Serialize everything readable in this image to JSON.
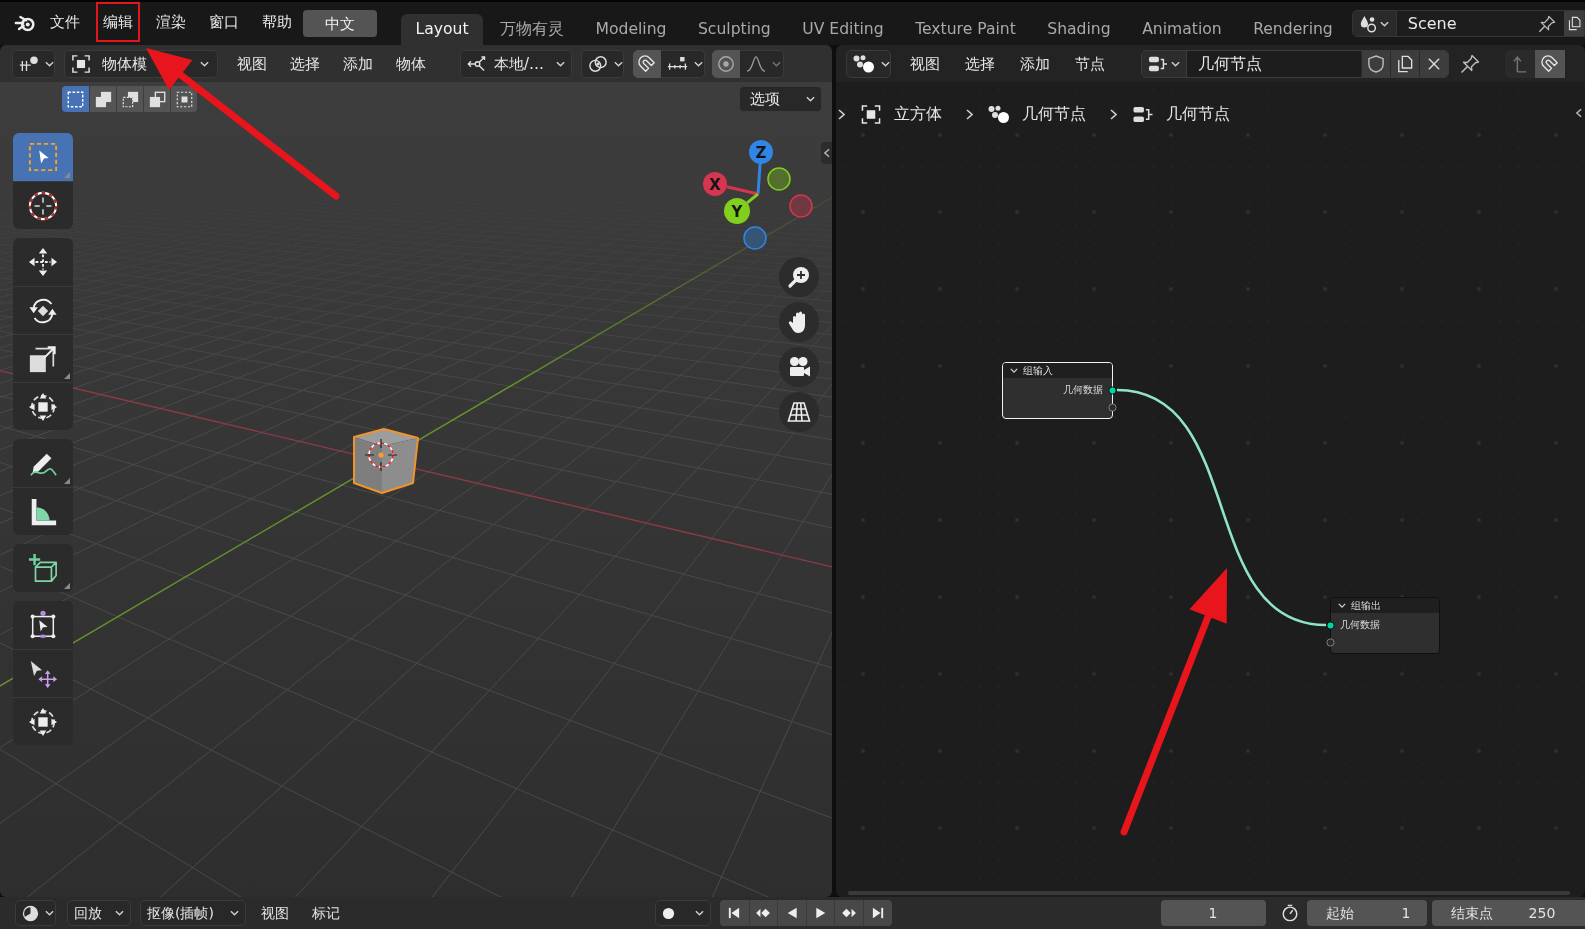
{
  "top_bar": {
    "menus": [
      {
        "label": "文件",
        "highlighted": false
      },
      {
        "label": "编辑",
        "highlighted": true
      },
      {
        "label": "渲染",
        "highlighted": false
      },
      {
        "label": "窗口",
        "highlighted": false
      },
      {
        "label": "帮助",
        "highlighted": false
      }
    ],
    "language": "中文",
    "workspaces": [
      {
        "label": "Layout",
        "selected": true
      },
      {
        "label": "万物有灵",
        "selected": false
      },
      {
        "label": "Modeling",
        "selected": false
      },
      {
        "label": "Sculpting",
        "selected": false
      },
      {
        "label": "UV Editing",
        "selected": false
      },
      {
        "label": "Texture Paint",
        "selected": false
      },
      {
        "label": "Shading",
        "selected": false
      },
      {
        "label": "Animation",
        "selected": false
      },
      {
        "label": "Rendering",
        "selected": false
      }
    ],
    "scene": "Scene"
  },
  "viewport": {
    "mode": "物体模",
    "menus": [
      "视图",
      "选择",
      "添加",
      "物体"
    ],
    "orientation": "本地/…",
    "select_modes": [
      {
        "kind": "set",
        "selected": true
      },
      {
        "kind": "extend",
        "selected": false
      },
      {
        "kind": "subtract",
        "selected": false
      },
      {
        "kind": "invert",
        "selected": false
      },
      {
        "kind": "intersect",
        "selected": false
      }
    ],
    "options": "选项",
    "tool_groups": [
      [
        {
          "kind": "select-box",
          "selected": true,
          "submenu": true
        },
        {
          "kind": "cursor",
          "selected": false,
          "submenu": false
        }
      ],
      [
        {
          "kind": "move",
          "selected": false,
          "submenu": false
        },
        {
          "kind": "rotate",
          "selected": false,
          "submenu": false
        },
        {
          "kind": "scale",
          "selected": false,
          "submenu": true
        },
        {
          "kind": "transform",
          "selected": false,
          "submenu": false
        }
      ],
      [
        {
          "kind": "annotate",
          "selected": false,
          "submenu": true
        },
        {
          "kind": "measure",
          "selected": false,
          "submenu": false
        }
      ],
      [
        {
          "kind": "add-cube",
          "selected": false,
          "submenu": true
        }
      ],
      [
        {
          "kind": "scale-cage",
          "selected": false,
          "submenu": false
        },
        {
          "kind": "select-move",
          "selected": false,
          "submenu": false
        },
        {
          "kind": "transform",
          "selected": false,
          "submenu": false
        }
      ]
    ],
    "axes": [
      {
        "label": "Z",
        "color": "#2f86e6"
      },
      {
        "label": "X",
        "color": "#d5354e"
      },
      {
        "label": "Y",
        "color": "#80cf1c"
      }
    ],
    "nav_buttons": [
      {
        "kind": "zoom"
      },
      {
        "kind": "pan"
      },
      {
        "kind": "camera"
      },
      {
        "kind": "perspective"
      }
    ]
  },
  "node_editor": {
    "menus": [
      "视图",
      "选择",
      "添加",
      "节点"
    ],
    "node_group": "几何节点",
    "breadcrumbs": [
      {
        "kind": "object",
        "label": "立方体"
      },
      {
        "kind": "modifier",
        "label": "几何节点"
      },
      {
        "kind": "node-group",
        "label": "几何节点"
      }
    ],
    "nodes": [
      {
        "kind": "input",
        "title": "组输入",
        "socket": "几何数据",
        "selected": true
      },
      {
        "kind": "output",
        "title": "组输出",
        "socket": "几何数据",
        "selected": false
      }
    ]
  },
  "timeline": {
    "menus": [
      {
        "label": "回放",
        "dropdown": true
      },
      {
        "label": "抠像(插帧)",
        "dropdown": true
      },
      {
        "label": "视图",
        "dropdown": false
      },
      {
        "label": "标记",
        "dropdown": false
      }
    ],
    "current_frame": "1",
    "start_label": "起始",
    "start": "1",
    "end_label": "结束点",
    "end": "250"
  }
}
